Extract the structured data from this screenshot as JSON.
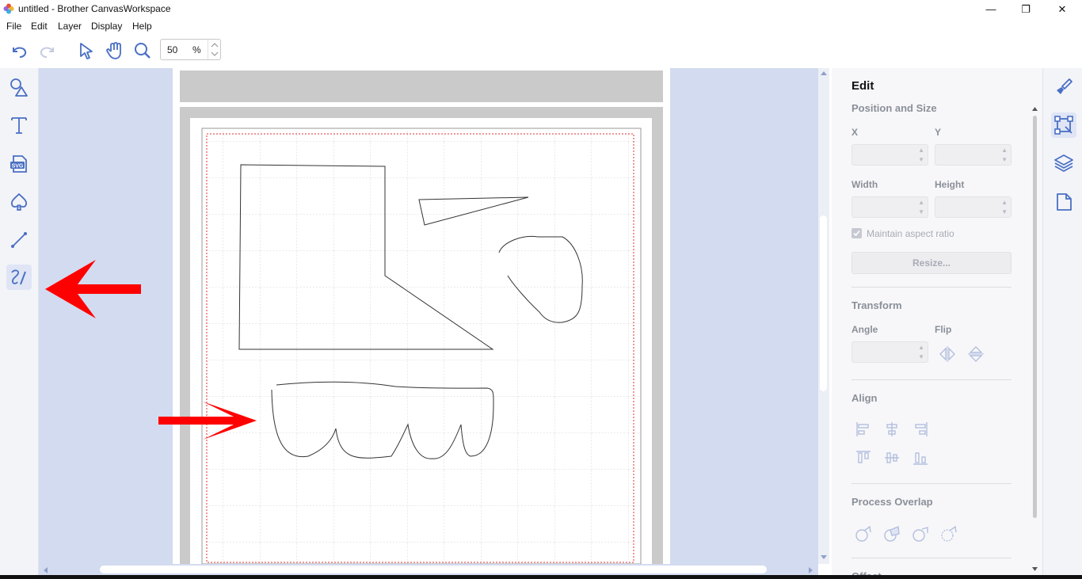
{
  "window": {
    "title": "untitled - Brother CanvasWorkspace",
    "minimize": "—",
    "restore": "❐",
    "close": "✕"
  },
  "menu": {
    "items": [
      "File",
      "Edit",
      "Layer",
      "Display",
      "Help"
    ]
  },
  "toolbar": {
    "zoom_value": "50",
    "zoom_unit": "%",
    "icons": [
      "undo-icon",
      "redo-icon",
      "select-arrow-icon",
      "hand-pan-icon",
      "zoom-magnifier-icon"
    ]
  },
  "left_tools": [
    {
      "name": "shapes-tool",
      "icon": "shapes-icon",
      "active": false
    },
    {
      "name": "text-tool",
      "icon": "text-t-icon",
      "active": false
    },
    {
      "name": "svg-import-tool",
      "icon": "svg-file-icon",
      "icon_text": "SVG",
      "active": false
    },
    {
      "name": "pattern-tool",
      "icon": "spade-icon",
      "active": false
    },
    {
      "name": "line-tool",
      "icon": "line-icon",
      "active": false
    },
    {
      "name": "freehand-tool",
      "icon": "freehand-pen-icon",
      "active": true
    }
  ],
  "edit_panel": {
    "title": "Edit",
    "position_size": {
      "heading": "Position and Size",
      "x_label": "X",
      "y_label": "Y",
      "width_label": "Width",
      "height_label": "Height",
      "maintain_aspect": "Maintain aspect ratio",
      "maintain_aspect_checked": true,
      "resize_button": "Resize..."
    },
    "transform": {
      "heading": "Transform",
      "angle_label": "Angle",
      "flip_label": "Flip"
    },
    "align": {
      "heading": "Align"
    },
    "process_overlap": {
      "heading": "Process Overlap"
    },
    "offset": {
      "heading": "Offset"
    }
  },
  "right_tools": [
    {
      "name": "paint-tool",
      "icon": "paintbrush-icon",
      "active": false
    },
    {
      "name": "edit-tool",
      "icon": "transform-box-icon",
      "active": true
    },
    {
      "name": "layers-tool",
      "icon": "layers-icon",
      "active": false
    },
    {
      "name": "page-tool",
      "icon": "page-icon",
      "active": false
    }
  ],
  "colors": {
    "accent": "#4a6fc4",
    "canvas_bg": "#d3dbf0",
    "annotation_arrow": "#ff0000",
    "safety_border": "#e03030"
  }
}
